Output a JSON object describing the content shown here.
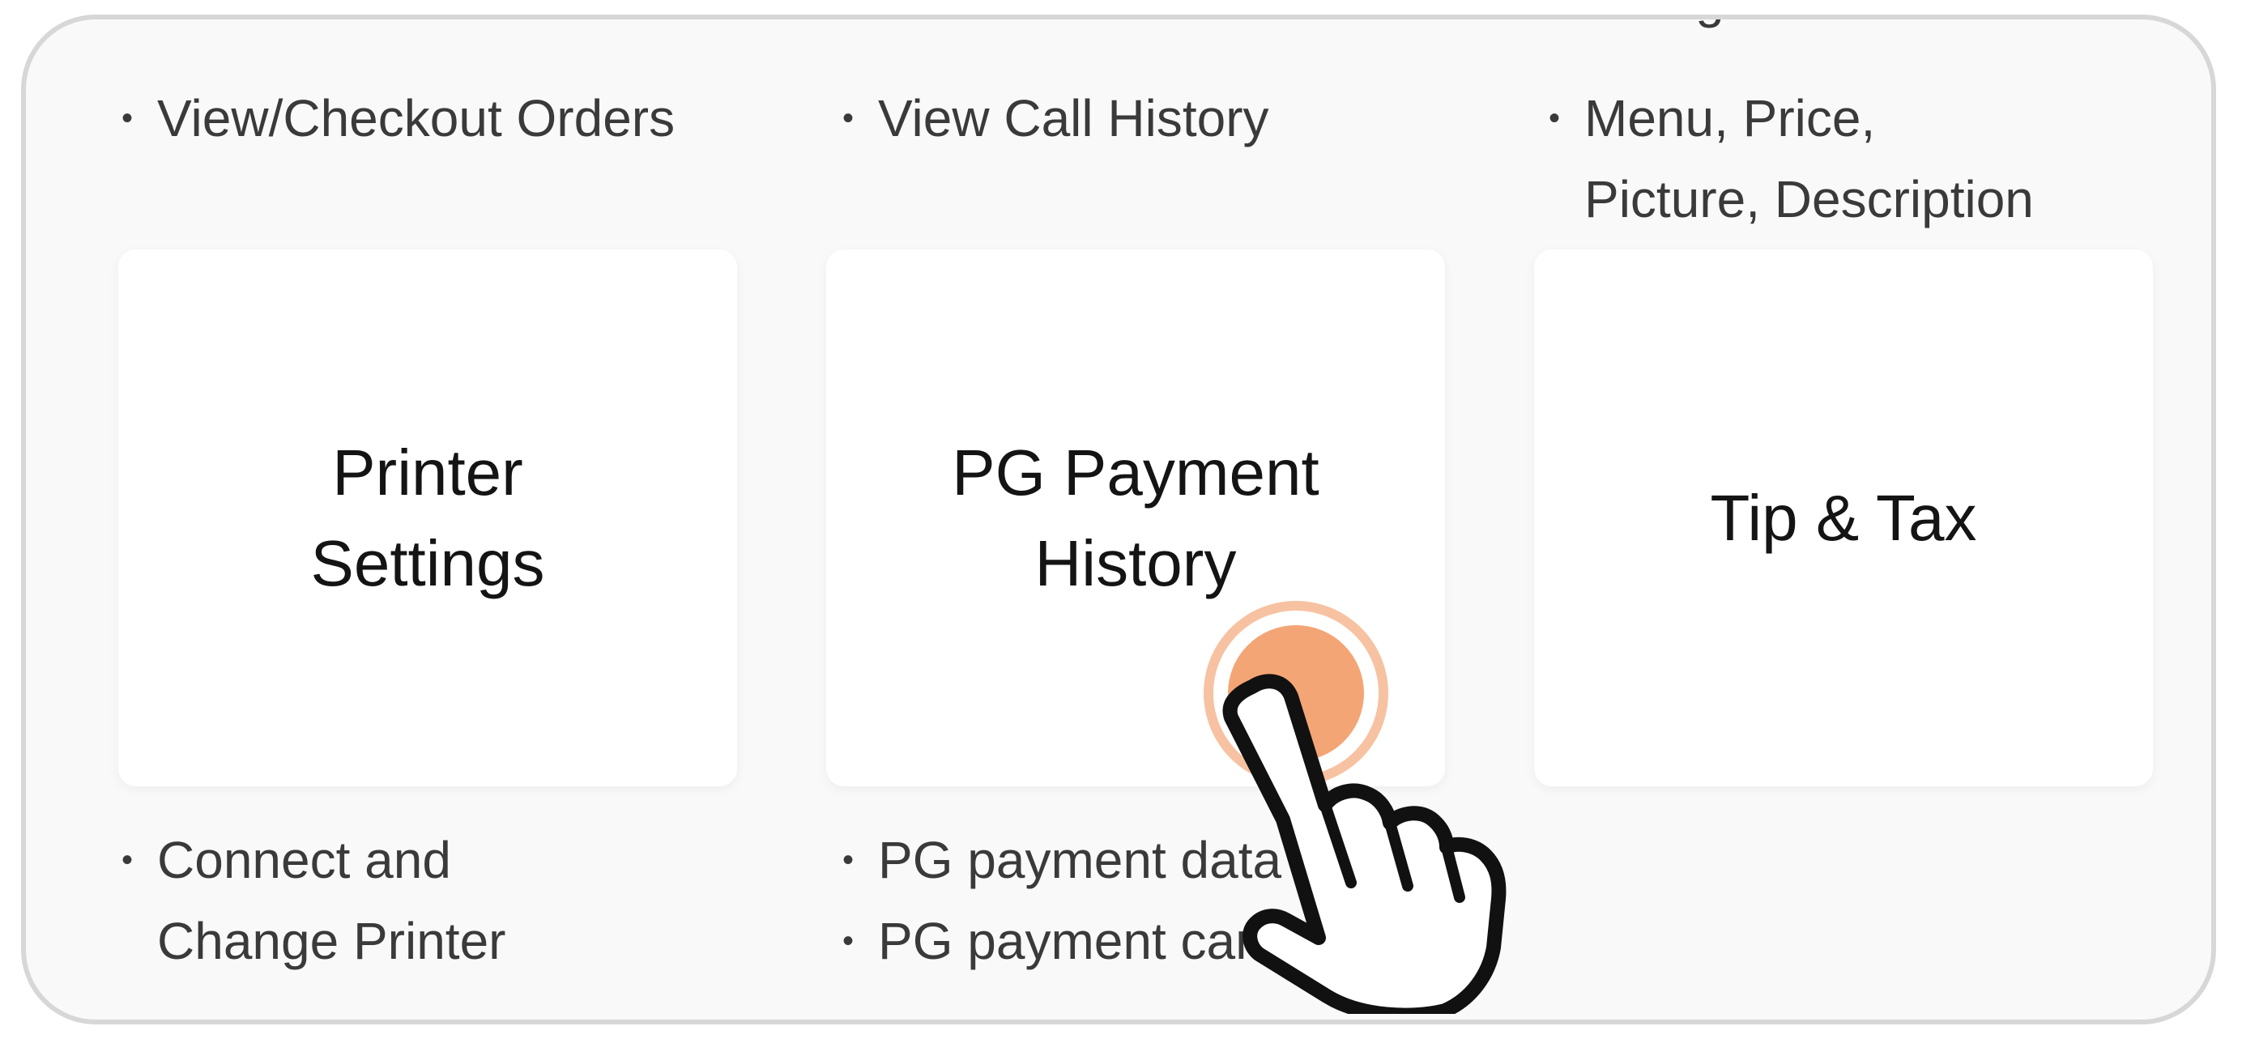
{
  "top_row": {
    "col1": [
      "View/Checkout Orders"
    ],
    "col2": [
      "View Call History"
    ],
    "col3_cut": "Categories",
    "col3": [
      "Menu, Price, Picture, Description"
    ]
  },
  "cards": [
    {
      "title": "Printer\nSettings"
    },
    {
      "title": "PG Payment\nHistory"
    },
    {
      "title": "Tip & Tax"
    }
  ],
  "bottom_row": {
    "col1": [
      "Connect and",
      "Change Printer"
    ],
    "col2": [
      "PG payment data",
      "PG payment cancel"
    ]
  },
  "colors": {
    "accent": "#f4a575",
    "frame_border": "#d7d7d7"
  },
  "icons": {
    "pointer": "hand-pointer-icon"
  }
}
